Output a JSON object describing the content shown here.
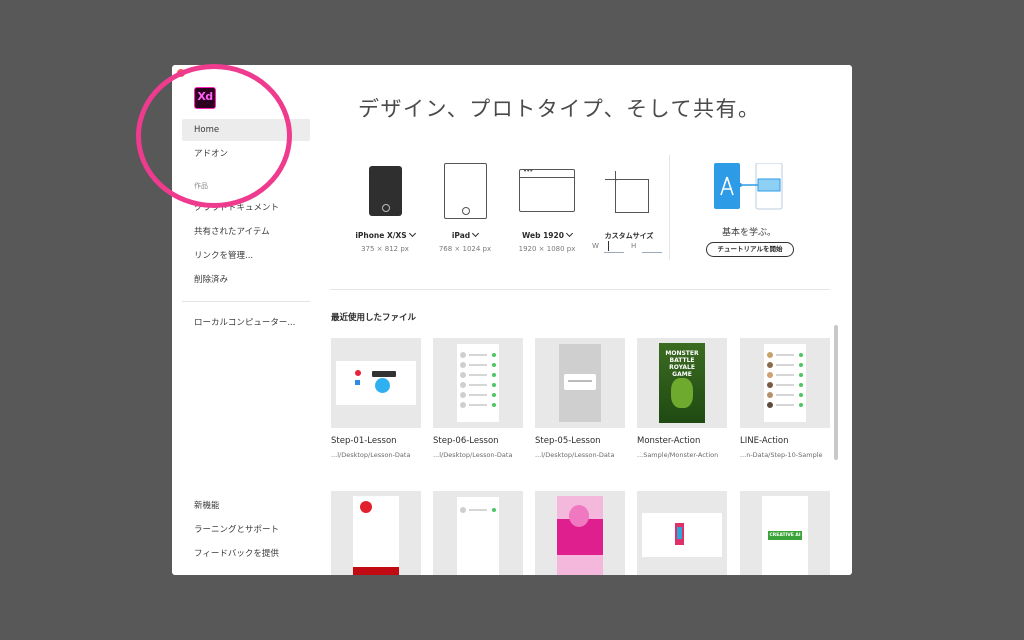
{
  "window": {
    "close_color": "#ee5b52"
  },
  "logo": {
    "text": "Xd",
    "icon": "xd-logo-icon"
  },
  "sidebar": {
    "items": [
      {
        "label": "Home",
        "active": true
      },
      {
        "label": "アドオン"
      }
    ],
    "works_heading": "作品",
    "work_items": [
      {
        "label": "クラウドドキュメント"
      },
      {
        "label": "共有されたアイテム"
      },
      {
        "label": "リンクを管理..."
      },
      {
        "label": "削除済み"
      }
    ],
    "local_item": {
      "label": "ローカルコンピューター..."
    },
    "footer_items": [
      {
        "label": "新機能"
      },
      {
        "label": "ラーニングとサポート"
      },
      {
        "label": "フィードバックを提供"
      }
    ]
  },
  "hero": {
    "title": "デザイン、プロトタイプ、そして共有。"
  },
  "presets": [
    {
      "name": "iPhone X/XS",
      "dims": "375 × 812 px",
      "icon": "phone-icon"
    },
    {
      "name": "iPad",
      "dims": "768 × 1024 px",
      "icon": "tablet-icon"
    },
    {
      "name": "Web 1920",
      "dims": "1920 × 1080 px",
      "icon": "browser-icon"
    },
    {
      "name": "カスタムサイズ",
      "icon": "custom-size-icon",
      "w_label": "W",
      "h_label": "H",
      "w_value": "",
      "h_value": ""
    }
  ],
  "learn": {
    "title": "基本を学ぶ。",
    "button": "チュートリアルを開始"
  },
  "recent": {
    "title": "最近使用したファイル",
    "files": [
      {
        "name": "Step-01-Lesson",
        "path": "...l/Desktop/Lesson-Data"
      },
      {
        "name": "Step-06-Lesson",
        "path": "...l/Desktop/Lesson-Data"
      },
      {
        "name": "Step-05-Lesson",
        "path": "...l/Desktop/Lesson-Data"
      },
      {
        "name": "Monster-Action",
        "path": "...Sample/Monster-Action"
      },
      {
        "name": "LINE-Action",
        "path": "...n-Data/Step-10-Sample"
      }
    ],
    "monster_thumb_text": [
      "MONSTER",
      "BATTLE ROYALE",
      "GAME"
    ],
    "creative_badge": "CREATIVE AI"
  },
  "colors": {
    "accent_ring": "#ee3b8e",
    "xd_pink": "#ff61f6",
    "line_green": "#4cc764"
  }
}
